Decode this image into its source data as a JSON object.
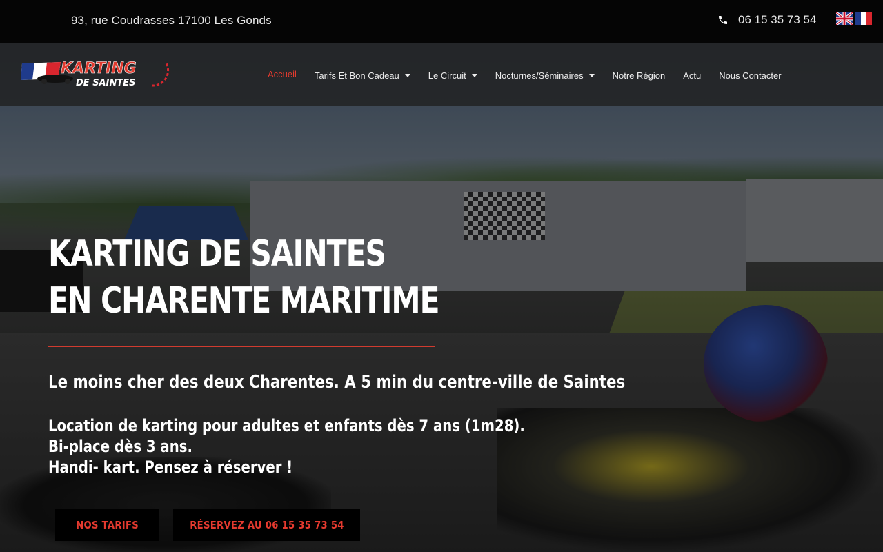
{
  "topbar": {
    "address": "93, rue Coudrasses 17100 Les Gonds",
    "phone": "06 15 35 73 54",
    "phone_icon": "phone-icon",
    "languages": [
      "English",
      "Français"
    ]
  },
  "header": {
    "logo_line1": "KARTING",
    "logo_line2": "DE SAINTES",
    "nav": [
      {
        "label": "Accueil",
        "active": true,
        "has_dropdown": false
      },
      {
        "label": "Tarifs Et Bon Cadeau",
        "active": false,
        "has_dropdown": true
      },
      {
        "label": "Le Circuit",
        "active": false,
        "has_dropdown": true
      },
      {
        "label": "Nocturnes/Séminaires",
        "active": false,
        "has_dropdown": true
      },
      {
        "label": "Notre Région",
        "active": false,
        "has_dropdown": false
      },
      {
        "label": "Actu",
        "active": false,
        "has_dropdown": false
      },
      {
        "label": "Nous Contacter",
        "active": false,
        "has_dropdown": false
      }
    ]
  },
  "hero": {
    "title_line1": "KARTING DE SAINTES",
    "title_line2": "EN CHARENTE MARITIME",
    "subtitle": "Le moins cher des deux Charentes. A 5 min du centre-ville de Saintes",
    "desc_line1": "Location de karting pour adultes et enfants dès 7 ans (1m28).",
    "desc_line2": "Bi-place dès 3 ans.",
    "desc_line3": "Handi- kart. Pensez à réserver !",
    "button_tarifs": "NOS TARIFS",
    "button_reserve": "RÉSERVEZ AU 06 15 35 73 54"
  },
  "colors": {
    "accent": "#e23a2e",
    "topbar_bg": "#050505",
    "button_bg": "#000000"
  }
}
